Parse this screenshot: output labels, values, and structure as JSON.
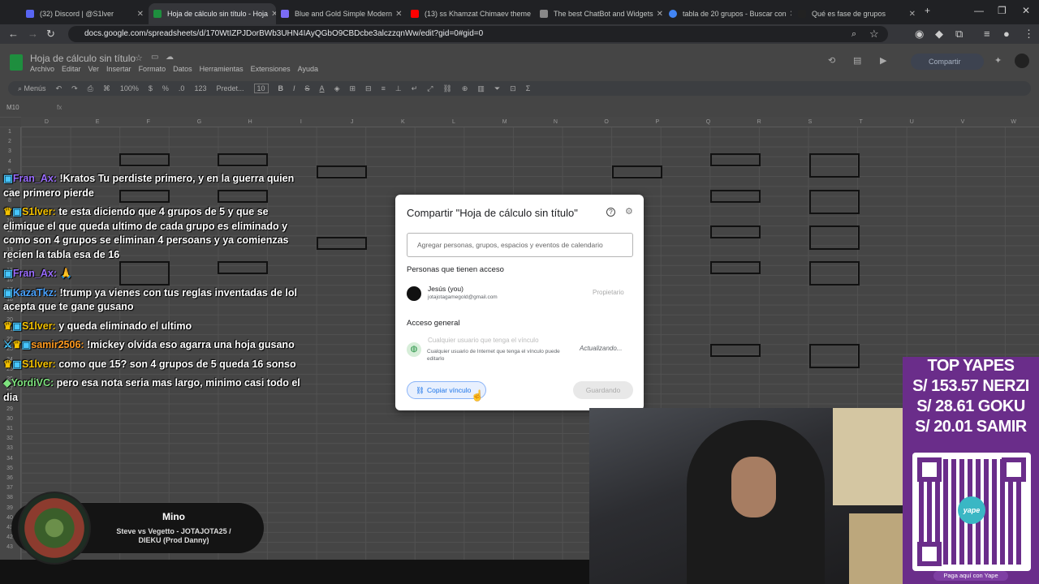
{
  "browser": {
    "tabs": [
      {
        "label": "(32) Discord | @S1lver",
        "color": "#5865f2"
      },
      {
        "label": "Hoja de cálculo sin título - Hoja",
        "color": "#1e8e3e",
        "active": true
      },
      {
        "label": "Blue and Gold Simple Modern",
        "color": "#7b6cf6"
      },
      {
        "label": "(13) ss Khamzat Chimaev theme",
        "color": "#ff0000"
      },
      {
        "label": "The best ChatBot and Widgets",
        "color": "#888888"
      },
      {
        "label": "tabla de 20 grupos - Buscar con",
        "color": "#4285f4"
      },
      {
        "label": "Qué es fase de grupos",
        "color": "#222222"
      }
    ],
    "new_tab": "+",
    "url": "docs.google.com/spreadsheets/d/170WtIZPJDorBWb3UHN4IAyQGbO9CBDcbe3alczzqnWw/edit?gid=0#gid=0"
  },
  "sheets": {
    "title": "Hoja de cálculo sin título",
    "menu": [
      "Archivo",
      "Editar",
      "Ver",
      "Insertar",
      "Formato",
      "Datos",
      "Herramientas",
      "Extensiones",
      "Ayuda"
    ],
    "toolbar": {
      "menus": "Menús",
      "zoom": "100%",
      "font": "Predet...",
      "font_size": "10",
      "number_format": "123"
    },
    "share_label": "Compartir",
    "name_box": "M10",
    "columns": [
      "D",
      "E",
      "F",
      "G",
      "H",
      "I",
      "J",
      "K",
      "L",
      "M",
      "N",
      "O",
      "P",
      "Q",
      "R",
      "S",
      "T",
      "U",
      "V",
      "W"
    ],
    "rows": [
      "1",
      "2",
      "3",
      "4",
      "5",
      "6",
      "7",
      "8",
      "9",
      "10",
      "11",
      "12",
      "13",
      "14",
      "15",
      "16",
      "17",
      "18",
      "19",
      "20",
      "21",
      "22",
      "23",
      "24",
      "25",
      "26",
      "27",
      "28",
      "29",
      "30",
      "31",
      "32",
      "33",
      "34",
      "35",
      "36",
      "37",
      "38",
      "39",
      "40",
      "41",
      "42",
      "43"
    ]
  },
  "dialog": {
    "title": "Compartir \"Hoja de cálculo sin título\"",
    "add_placeholder": "Agregar personas, grupos, espacios y eventos de calendario",
    "people_heading": "Personas que tienen acceso",
    "owner_name": "Jesús (you)",
    "owner_email": "jotajotagamegold@gmail.com",
    "owner_role": "Propietario",
    "general_heading": "Acceso general",
    "general_option": "Cualquier usuario que tenga el vínculo",
    "general_desc": "Cualquier usuario de Internet que tenga el vínculo puede editarlo",
    "general_role": "Actualizando...",
    "copy_link": "Copiar vínculo",
    "save": "Guardando"
  },
  "chat": [
    {
      "user": "Fran_Ax:",
      "text": "!Kratos Tu perdiste primero, y en la guerra quien cae primero pierde"
    },
    {
      "user": "S1lver:",
      "text": "te esta diciendo que 4 grupos de 5 y que se elimique el que queda ultimo de cada grupo es eliminado y como son 4 grupos se eliminan 4 persoans y ya comienzas recien la tabla esa de 16"
    },
    {
      "user": "Fran_Ax:",
      "text": ""
    },
    {
      "user": "KazaTkz:",
      "text": "!trump ya vienes con tus reglas inventadas de lol acepta que te gane gusano"
    },
    {
      "user": "S1lver:",
      "text": "y queda eliminado el ultimo"
    },
    {
      "user": "samir2506:",
      "text": "!mickey olvida eso agarra una hoja gusano"
    },
    {
      "user": "S1lver:",
      "text": "como que 15? son 4 grupos de 5 queda 16 sonso"
    },
    {
      "user": "YordiVC:",
      "text": "pero esa nota seria mas largo, minimo casi todo el dia"
    }
  ],
  "now_playing": {
    "artist": "Mino",
    "title": "Steve vs Vegetto - JOTAJOTA25 / DIEKU (Prod Danny)"
  },
  "donations": {
    "heading": "TOP YAPES",
    "entries": [
      "S/ 153.57 NERZI",
      "S/ 28.61 GOKU",
      "S/ 20.01 SAMIR"
    ],
    "logo": "yape",
    "pay_label": "Paga aquí con Yape"
  },
  "colors": {
    "accent": "#1a73e8",
    "sheets_green": "#1e8e3e",
    "yape_purple": "#6a2d8a"
  }
}
